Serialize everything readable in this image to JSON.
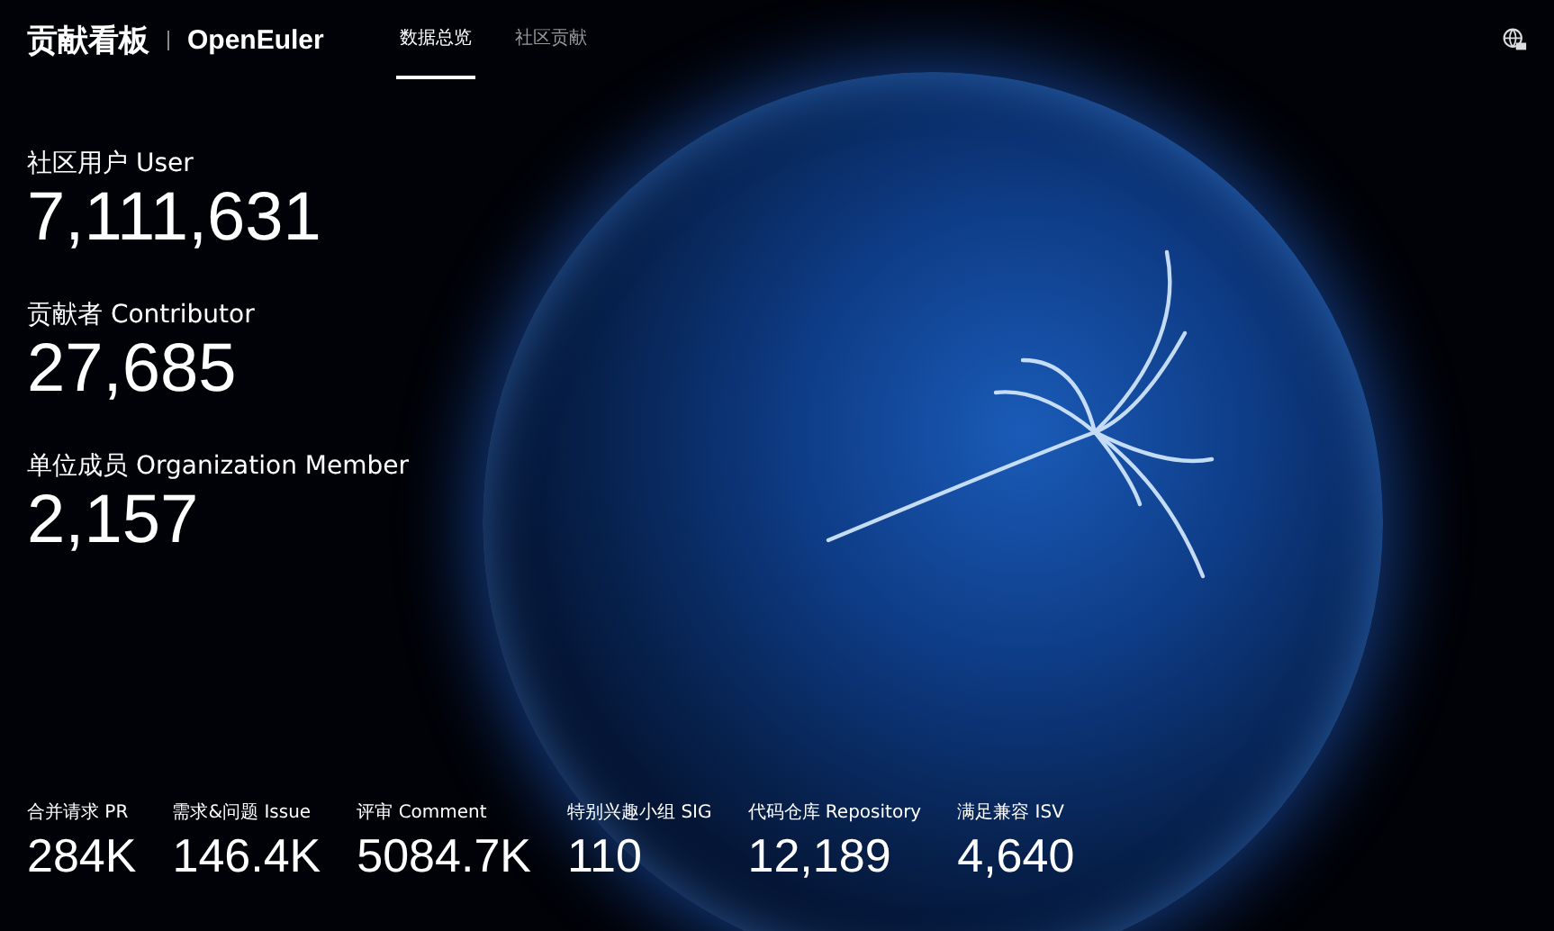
{
  "header": {
    "title": "贡献看板",
    "brand": "OpenEuler",
    "tabs": [
      {
        "label": "数据总览",
        "selected": true
      },
      {
        "label": "社区贡献",
        "selected": false
      }
    ]
  },
  "main_stats": [
    {
      "label": "社区用户 User",
      "value": "7,111,631"
    },
    {
      "label": "贡献者 Contributor",
      "value": "27,685"
    },
    {
      "label": "单位成员 Organization Member",
      "value": "2,157"
    }
  ],
  "bottom_stats": [
    {
      "label": "合并请求 PR",
      "value": "284K"
    },
    {
      "label": "需求&问题 Issue",
      "value": "146.4K"
    },
    {
      "label": "评审 Comment",
      "value": "5084.7K"
    },
    {
      "label": "特别兴趣小组 SIG",
      "value": "110"
    },
    {
      "label": "代码仓库 Repository",
      "value": "12,189"
    },
    {
      "label": "满足兼容 ISV",
      "value": "4,640"
    }
  ]
}
